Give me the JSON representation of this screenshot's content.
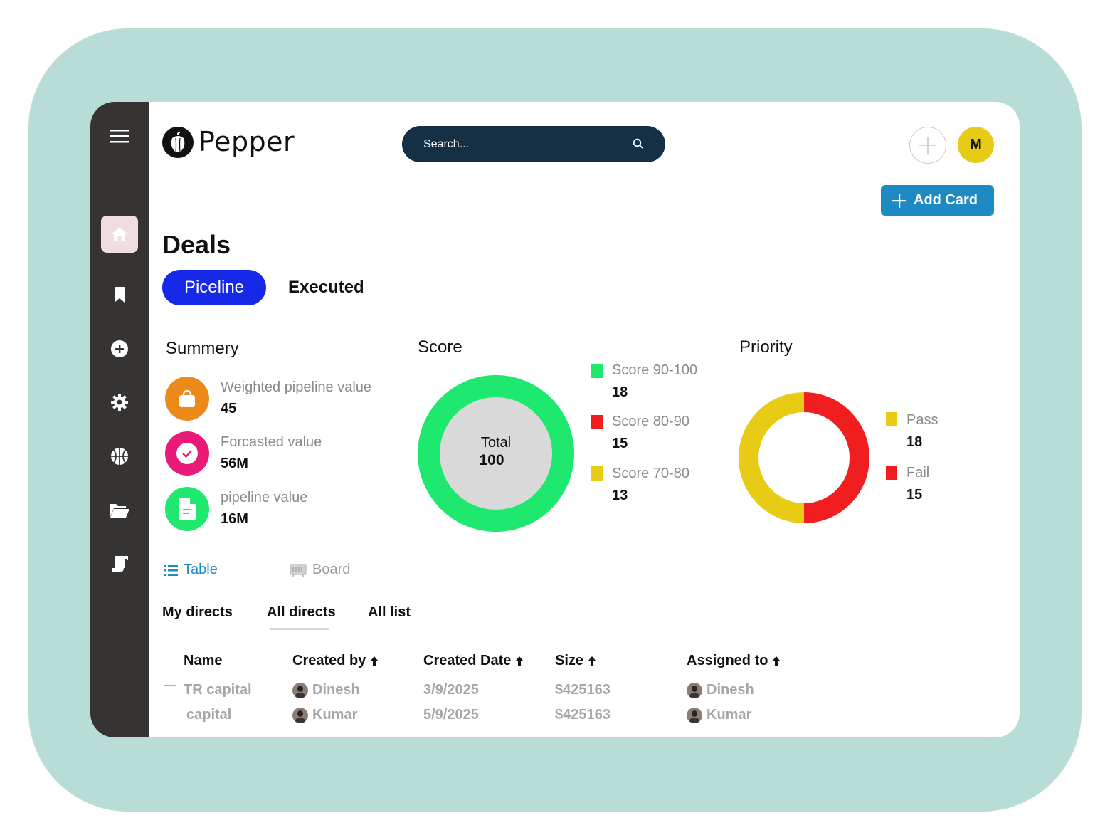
{
  "app": {
    "brand": "Pepper"
  },
  "search": {
    "placeholder": "Search..."
  },
  "header": {
    "avatar_initial": "M",
    "add_card_label": "Add Card"
  },
  "page": {
    "title": "Deals"
  },
  "tabs": {
    "active": "Piceline",
    "other": "Executed"
  },
  "summary": {
    "title": "Summery",
    "items": [
      {
        "label": "Weighted pipeline value",
        "value": "45",
        "icon": "bag-icon",
        "color": "#ec8a1a"
      },
      {
        "label": "Forcasted value",
        "value": "56M",
        "icon": "check-circle-icon",
        "color": "#ea1a78"
      },
      {
        "label": "pipeline value",
        "value": "16M",
        "icon": "document-icon",
        "color": "#1ee86e"
      }
    ]
  },
  "score": {
    "title": "Score",
    "center_label": "Total",
    "center_value": "100",
    "legend": [
      {
        "label": "Score 90-100",
        "value": "18",
        "color": "#1ee86e"
      },
      {
        "label": "Score 80-90",
        "value": "15",
        "color": "#f01e1e"
      },
      {
        "label": "Score 70-80",
        "value": "13",
        "color": "#e8cb14"
      }
    ]
  },
  "priority": {
    "title": "Priority",
    "legend": [
      {
        "label": "Pass",
        "value": "18",
        "color": "#e8cb14"
      },
      {
        "label": "Fail",
        "value": "15",
        "color": "#f01e1e"
      }
    ]
  },
  "view": {
    "table_label": "Table",
    "board_label": "Board",
    "active": "Table"
  },
  "subtabs": {
    "items": [
      "My directs",
      "All directs",
      "All list"
    ],
    "active": "All directs"
  },
  "table": {
    "columns": [
      "Name",
      "Created by",
      "Created Date",
      "Size",
      "Assigned to"
    ],
    "rows": [
      {
        "name": "TR capital",
        "created_by": "Dinesh",
        "created_date": "3/9/2025",
        "size": "$425163",
        "assigned_to": "Dinesh"
      },
      {
        "name": "capital",
        "created_by": "Kumar",
        "created_date": "5/9/2025",
        "size": "$425163",
        "assigned_to": "Kumar"
      }
    ]
  },
  "colors": {
    "frame": "#b8dcd6",
    "sidebar": "#363333",
    "search_bg": "#152f45",
    "accent_blue": "#1628e8",
    "add_card": "#1e8ac4",
    "table_link": "#1e8ac4"
  }
}
